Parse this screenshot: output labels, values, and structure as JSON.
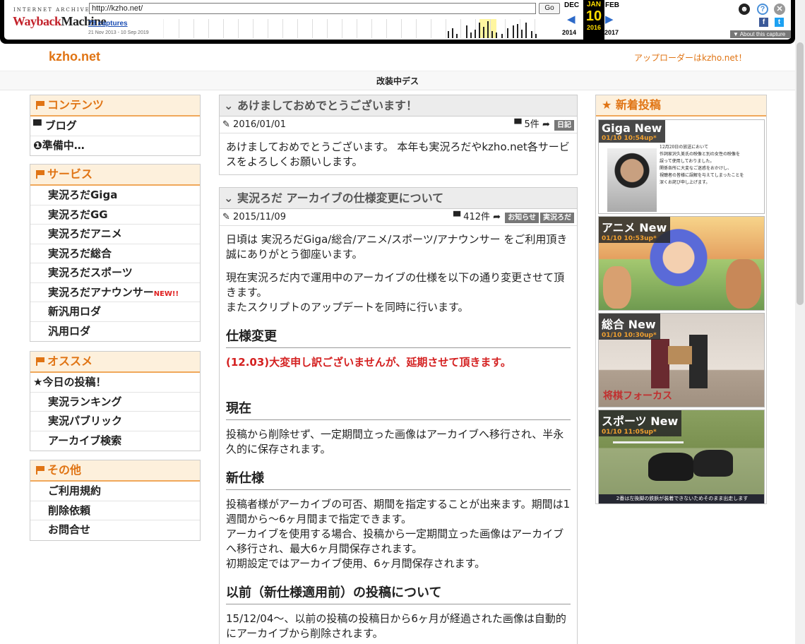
{
  "wayback": {
    "logo_top": "INTERNET ARCHIVE",
    "logo_main_1": "Wayback",
    "logo_main_2": "Machine",
    "url": "http://kzho.net/",
    "go_label": "Go",
    "captures": "73 captures",
    "range": "21 Nov 2013 - 10 Sep 2019",
    "prev_month": "DEC",
    "cur_month": "JAN",
    "next_month": "FEB",
    "day": "10",
    "prev_year": "2014",
    "cur_year": "2016",
    "next_year": "2017",
    "about": "▼ About this capture",
    "colors": {
      "frame": "#000000",
      "highlight": "#ffde00",
      "link": "#1a4db3"
    }
  },
  "header": {
    "site_name": "kzho.net",
    "uploader": "アップローダーはkzho.net！",
    "notice": "改装中デス"
  },
  "sidebar": {
    "contents": {
      "title": "コンテンツ",
      "items": [
        "ブログ",
        "準備中…"
      ]
    },
    "service": {
      "title": "サービス",
      "items": [
        "実況ろだGiga",
        "実況ろだGG",
        "実況ろだアニメ",
        "実況ろだ総合",
        "実況ろだスポーツ",
        "実況ろだアナウンサー",
        "新汎用ロダ",
        "汎用ロダ"
      ],
      "new_badge": "NEW!!"
    },
    "recommend": {
      "title": "オススメ",
      "items": [
        "★今日の投稿！",
        "実況ランキング",
        "実況パブリック",
        "アーカイブ検索"
      ]
    },
    "other": {
      "title": "その他",
      "items": [
        "ご利用規約",
        "削除依頼",
        "お問合せ"
      ]
    }
  },
  "posts": [
    {
      "title": "あけましておめでとうございます！",
      "date": "2016/01/01",
      "comments": "5件",
      "tags": [
        "日記"
      ],
      "body": "あけましておめでとうございます。 本年も実況ろだやkzho.net各サービスをよろしくお願いします。"
    },
    {
      "title": "実況ろだ アーカイブの仕様変更について",
      "date": "2015/11/09",
      "comments": "412件",
      "tags": [
        "お知らせ",
        "実況ろだ"
      ],
      "p1": "日頃は 実況ろだGiga/総合/アニメ/スポーツ/アナウンサー をご利用頂き誠にありがとう御座います。",
      "p2a": "現在実況ろだ内で運用中のアーカイブの仕様を以下の通り変更させて頂きます。",
      "p2b": "またスクリプトのアップデートを同時に行います。",
      "h_spec": "仕様変更",
      "red_note": "(12.03)大変申し訳ございませんが、延期させて頂きます。",
      "h_current": "現在",
      "current": "投稿から削除せず、一定期間立った画像はアーカイブへ移行され、半永久的に保存されます。",
      "h_new": "新仕様",
      "new1": "投稿者様がアーカイブの可否、期間を指定することが出来ます。期間は1週間から～6ヶ月間まで指定できます。",
      "new2": "アーカイブを使用する場合、投稿から一定期間立った画像はアーカイブへ移行され、最大6ヶ月間保存されます。",
      "new3": "初期設定ではアーカイブ使用、6ヶ月間保存されます。",
      "h_before": "以前（新仕様適用前）の投稿について",
      "before": "15/12/04～、以前の投稿の投稿日から6ヶ月が経過された画像は自動的にアーカイブから削除されます。"
    }
  ],
  "new_posts": {
    "title": "新着投稿",
    "items": [
      {
        "label": "Giga New",
        "time": "01/10 10:54up*",
        "text": [
          "12月20日の放送において",
          "作詞家沢久美氏の映像と別の女性の映像を",
          "誤って使用しておりました。",
          "関係各所に大変なご迷惑をおかけし、",
          "視聴者の皆様に誤解を与えてしまったことを",
          "深くお詫び申し上げます。"
        ]
      },
      {
        "label": "アニメ New",
        "time": "01/10 10:53up*"
      },
      {
        "label": "総合 New",
        "time": "01/10 10:30up*",
        "caption": "将棋フォーカス"
      },
      {
        "label": "スポーツ New",
        "time": "01/10 11:05up*",
        "caption": "2番は左後脚の鉄鋲が装着できないためそのまま出走します"
      }
    ]
  }
}
